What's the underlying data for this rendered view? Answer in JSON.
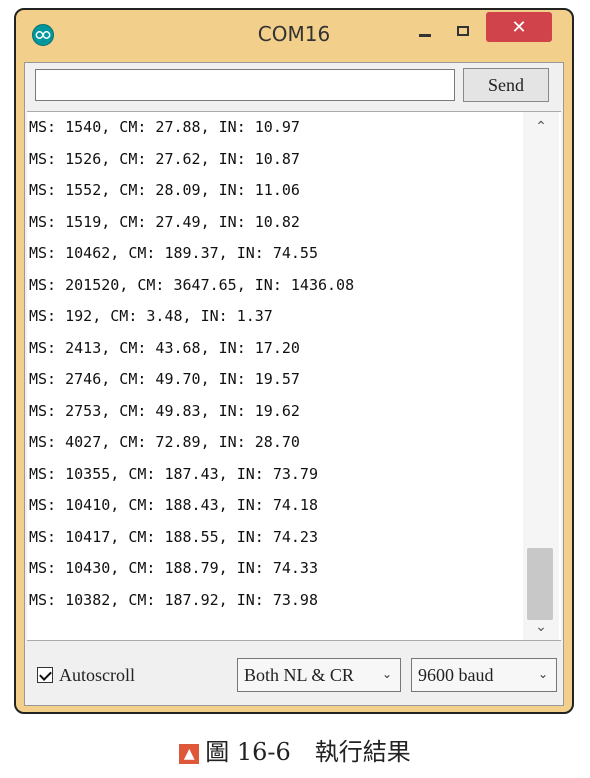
{
  "window": {
    "title": "COM16",
    "close_glyph": "✕"
  },
  "send": {
    "input_value": "",
    "button_label": "Send"
  },
  "serial_output": [
    "MS: 1540, CM: 27.88, IN: 10.97",
    "MS: 1526, CM: 27.62, IN: 10.87",
    "MS: 1552, CM: 28.09, IN: 11.06",
    "MS: 1519, CM: 27.49, IN: 10.82",
    "MS: 10462, CM: 189.37, IN: 74.55",
    "MS: 201520, CM: 3647.65, IN: 1436.08",
    "MS: 192, CM: 3.48, IN: 1.37",
    "MS: 2413, CM: 43.68, IN: 17.20",
    "MS: 2746, CM: 49.70, IN: 19.57",
    "MS: 2753, CM: 49.83, IN: 19.62",
    "MS: 4027, CM: 72.89, IN: 28.70",
    "MS: 10355, CM: 187.43, IN: 73.79",
    "MS: 10410, CM: 188.43, IN: 74.18",
    "MS: 10417, CM: 188.55, IN: 74.23",
    "MS: 10430, CM: 188.79, IN: 74.33",
    "MS: 10382, CM: 187.92, IN: 73.98"
  ],
  "footer": {
    "autoscroll_label": "Autoscroll",
    "autoscroll_checked": true,
    "line_ending": "Both NL & CR",
    "baud_rate": "9600 baud"
  },
  "caption": {
    "text": "圖 16-6　執行結果"
  },
  "colors": {
    "window_frame": "#f2cf8a",
    "close_button": "#d0434b",
    "app_icon": "#00979c"
  },
  "icons": [
    "arduino-icon",
    "minimize-icon",
    "maximize-icon",
    "close-icon",
    "scroll-up-icon",
    "scroll-down-icon",
    "chevron-down-icon",
    "up-arrow-icon"
  ]
}
